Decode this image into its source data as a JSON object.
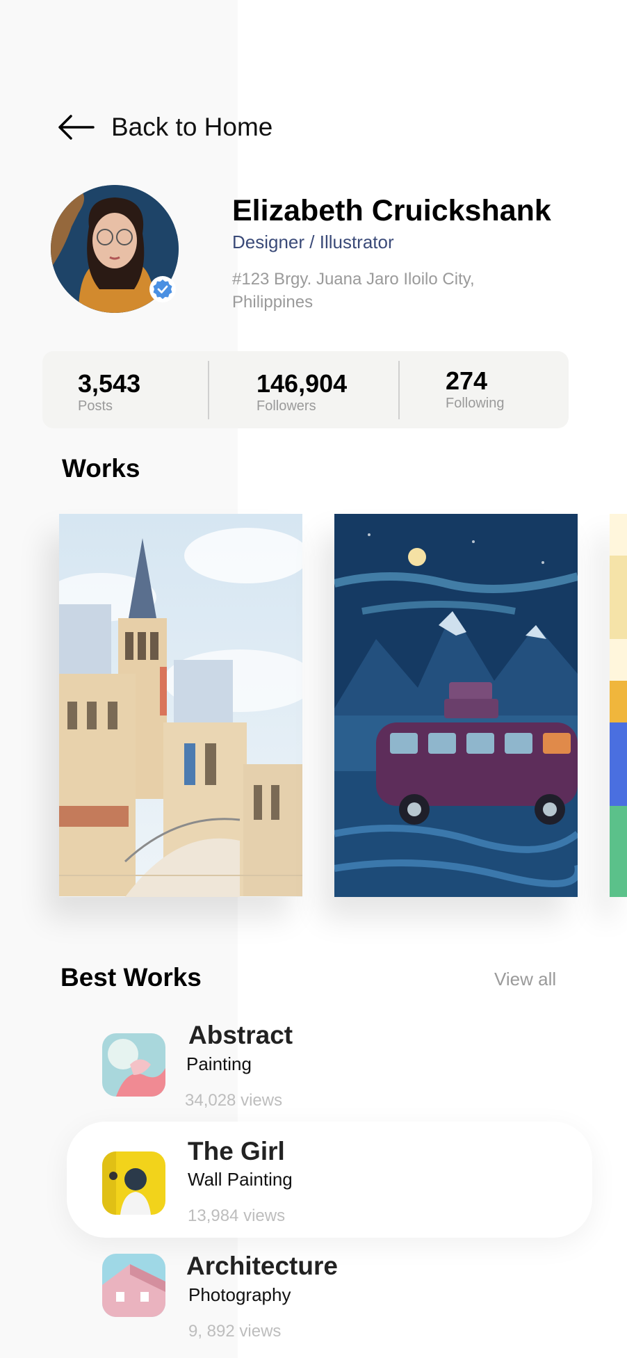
{
  "nav": {
    "back_label": "Back to Home"
  },
  "profile": {
    "name": "Elizabeth Cruickshank",
    "role": "Designer / Illustrator",
    "address": "#123 Brgy. Juana Jaro Iloilo City, Philippines"
  },
  "stats": [
    {
      "value": "3,543",
      "label": "Posts"
    },
    {
      "value": "146,904",
      "label": "Followers"
    },
    {
      "value": "274",
      "label": "Following"
    }
  ],
  "works": {
    "title": "Works"
  },
  "best_works": {
    "title": "Best Works",
    "view_all_label": "View all",
    "items": [
      {
        "title": "Abstract",
        "category": "Painting",
        "views": "34,028 views"
      },
      {
        "title": "The Girl",
        "category": "Wall Painting",
        "views": "13,984 views"
      },
      {
        "title": "Architecture",
        "category": "Photography",
        "views": "9, 892 views"
      }
    ]
  },
  "colors": {
    "accent_blue": "#4a90e2",
    "role_text": "#3a4a78",
    "muted_text": "#9a9a9a",
    "stats_bg": "#f4f4f2"
  }
}
